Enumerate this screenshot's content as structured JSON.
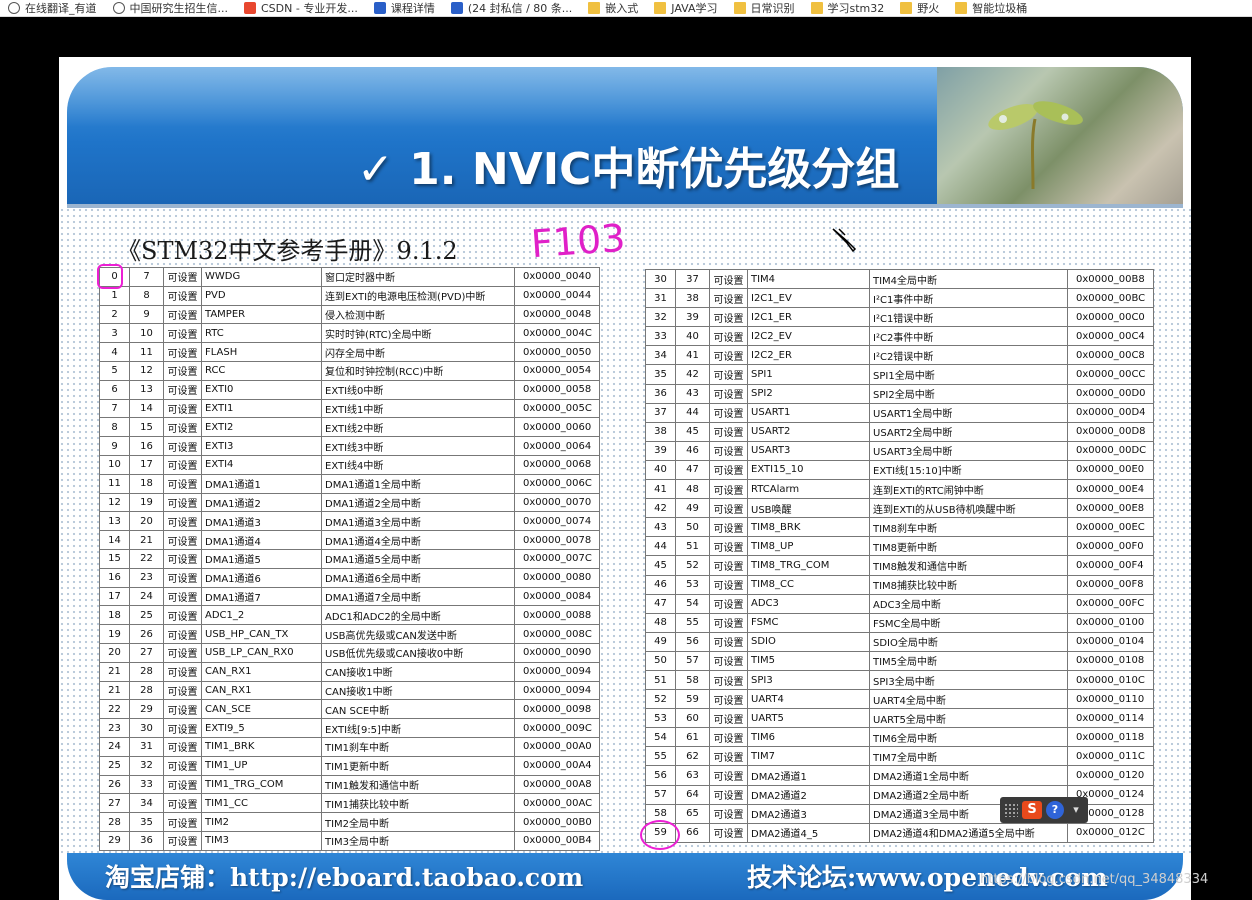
{
  "bookmarks": [
    {
      "icon": "globe-icon",
      "label": "在线翻译_有道"
    },
    {
      "icon": "globe-icon",
      "label": "中国研究生招生信..."
    },
    {
      "icon": "csdn-icon",
      "label": "CSDN - 专业开发..."
    },
    {
      "icon": "doc-icon",
      "label": "课程详情"
    },
    {
      "icon": "xu-icon",
      "label": "(24 封私信 / 80 条..."
    },
    {
      "icon": "folder-icon",
      "label": "嵌入式"
    },
    {
      "icon": "folder-icon",
      "label": "JAVA学习"
    },
    {
      "icon": "folder-icon",
      "label": "日常识别"
    },
    {
      "icon": "folder-icon",
      "label": "学习stm32"
    },
    {
      "icon": "folder-icon",
      "label": "野火"
    },
    {
      "icon": "folder-icon",
      "label": "智能垃圾桶"
    }
  ],
  "slide": {
    "title": "✓ 1. NVIC中断优先级分组",
    "subtitle": "《STM32中文参考手册》9.1.2",
    "annotation": "F103",
    "footer_shop": "淘宝店铺：http://eboard.taobao.com",
    "footer_forum": "技术论坛:www.openedv.com"
  },
  "table_left": [
    [
      "0",
      "7",
      "可设置",
      "WWDG",
      "窗口定时器中断",
      "0x0000_0040"
    ],
    [
      "1",
      "8",
      "可设置",
      "PVD",
      "连到EXTI的电源电压检测(PVD)中断",
      "0x0000_0044"
    ],
    [
      "2",
      "9",
      "可设置",
      "TAMPER",
      "侵入检测中断",
      "0x0000_0048"
    ],
    [
      "3",
      "10",
      "可设置",
      "RTC",
      "实时时钟(RTC)全局中断",
      "0x0000_004C"
    ],
    [
      "4",
      "11",
      "可设置",
      "FLASH",
      "闪存全局中断",
      "0x0000_0050"
    ],
    [
      "5",
      "12",
      "可设置",
      "RCC",
      "复位和时钟控制(RCC)中断",
      "0x0000_0054"
    ],
    [
      "6",
      "13",
      "可设置",
      "EXTI0",
      "EXTI线0中断",
      "0x0000_0058"
    ],
    [
      "7",
      "14",
      "可设置",
      "EXTI1",
      "EXTI线1中断",
      "0x0000_005C"
    ],
    [
      "8",
      "15",
      "可设置",
      "EXTI2",
      "EXTI线2中断",
      "0x0000_0060"
    ],
    [
      "9",
      "16",
      "可设置",
      "EXTI3",
      "EXTI线3中断",
      "0x0000_0064"
    ],
    [
      "10",
      "17",
      "可设置",
      "EXTI4",
      "EXTI线4中断",
      "0x0000_0068"
    ],
    [
      "11",
      "18",
      "可设置",
      "DMA1通道1",
      "DMA1通道1全局中断",
      "0x0000_006C"
    ],
    [
      "12",
      "19",
      "可设置",
      "DMA1通道2",
      "DMA1通道2全局中断",
      "0x0000_0070"
    ],
    [
      "13",
      "20",
      "可设置",
      "DMA1通道3",
      "DMA1通道3全局中断",
      "0x0000_0074"
    ],
    [
      "14",
      "21",
      "可设置",
      "DMA1通道4",
      "DMA1通道4全局中断",
      "0x0000_0078"
    ],
    [
      "15",
      "22",
      "可设置",
      "DMA1通道5",
      "DMA1通道5全局中断",
      "0x0000_007C"
    ],
    [
      "16",
      "23",
      "可设置",
      "DMA1通道6",
      "DMA1通道6全局中断",
      "0x0000_0080"
    ],
    [
      "17",
      "24",
      "可设置",
      "DMA1通道7",
      "DMA1通道7全局中断",
      "0x0000_0084"
    ],
    [
      "18",
      "25",
      "可设置",
      "ADC1_2",
      "ADC1和ADC2的全局中断",
      "0x0000_0088"
    ],
    [
      "19",
      "26",
      "可设置",
      "USB_HP_CAN_TX",
      "USB高优先级或CAN发送中断",
      "0x0000_008C"
    ],
    [
      "20",
      "27",
      "可设置",
      "USB_LP_CAN_RX0",
      "USB低优先级或CAN接收0中断",
      "0x0000_0090"
    ],
    [
      "21",
      "28",
      "可设置",
      "CAN_RX1",
      "CAN接收1中断",
      "0x0000_0094"
    ],
    [
      "21",
      "28",
      "可设置",
      "CAN_RX1",
      "CAN接收1中断",
      "0x0000_0094"
    ],
    [
      "22",
      "29",
      "可设置",
      "CAN_SCE",
      "CAN SCE中断",
      "0x0000_0098"
    ],
    [
      "23",
      "30",
      "可设置",
      "EXTI9_5",
      "EXTI线[9:5]中断",
      "0x0000_009C"
    ],
    [
      "24",
      "31",
      "可设置",
      "TIM1_BRK",
      "TIM1刹车中断",
      "0x0000_00A0"
    ],
    [
      "25",
      "32",
      "可设置",
      "TIM1_UP",
      "TIM1更新中断",
      "0x0000_00A4"
    ],
    [
      "26",
      "33",
      "可设置",
      "TIM1_TRG_COM",
      "TIM1触发和通信中断",
      "0x0000_00A8"
    ],
    [
      "27",
      "34",
      "可设置",
      "TIM1_CC",
      "TIM1捕获比较中断",
      "0x0000_00AC"
    ],
    [
      "28",
      "35",
      "可设置",
      "TIM2",
      "TIM2全局中断",
      "0x0000_00B0"
    ],
    [
      "29",
      "36",
      "可设置",
      "TIM3",
      "TIM3全局中断",
      "0x0000_00B4"
    ]
  ],
  "table_right": [
    [
      "30",
      "37",
      "可设置",
      "TIM4",
      "TIM4全局中断",
      "0x0000_00B8"
    ],
    [
      "31",
      "38",
      "可设置",
      "I2C1_EV",
      "I²C1事件中断",
      "0x0000_00BC"
    ],
    [
      "32",
      "39",
      "可设置",
      "I2C1_ER",
      "I²C1错误中断",
      "0x0000_00C0"
    ],
    [
      "33",
      "40",
      "可设置",
      "I2C2_EV",
      "I²C2事件中断",
      "0x0000_00C4"
    ],
    [
      "34",
      "41",
      "可设置",
      "I2C2_ER",
      "I²C2错误中断",
      "0x0000_00C8"
    ],
    [
      "35",
      "42",
      "可设置",
      "SPI1",
      "SPI1全局中断",
      "0x0000_00CC"
    ],
    [
      "36",
      "43",
      "可设置",
      "SPI2",
      "SPI2全局中断",
      "0x0000_00D0"
    ],
    [
      "37",
      "44",
      "可设置",
      "USART1",
      "USART1全局中断",
      "0x0000_00D4"
    ],
    [
      "38",
      "45",
      "可设置",
      "USART2",
      "USART2全局中断",
      "0x0000_00D8"
    ],
    [
      "39",
      "46",
      "可设置",
      "USART3",
      "USART3全局中断",
      "0x0000_00DC"
    ],
    [
      "40",
      "47",
      "可设置",
      "EXTI15_10",
      "EXTI线[15:10]中断",
      "0x0000_00E0"
    ],
    [
      "41",
      "48",
      "可设置",
      "RTCAlarm",
      "连到EXTI的RTC闹钟中断",
      "0x0000_00E4"
    ],
    [
      "42",
      "49",
      "可设置",
      "USB唤醒",
      "连到EXTI的从USB待机唤醒中断",
      "0x0000_00E8"
    ],
    [
      "43",
      "50",
      "可设置",
      "TIM8_BRK",
      "TIM8刹车中断",
      "0x0000_00EC"
    ],
    [
      "44",
      "51",
      "可设置",
      "TIM8_UP",
      "TIM8更新中断",
      "0x0000_00F0"
    ],
    [
      "45",
      "52",
      "可设置",
      "TIM8_TRG_COM",
      "TIM8触发和通信中断",
      "0x0000_00F4"
    ],
    [
      "46",
      "53",
      "可设置",
      "TIM8_CC",
      "TIM8捕获比较中断",
      "0x0000_00F8"
    ],
    [
      "47",
      "54",
      "可设置",
      "ADC3",
      "ADC3全局中断",
      "0x0000_00FC"
    ],
    [
      "48",
      "55",
      "可设置",
      "FSMC",
      "FSMC全局中断",
      "0x0000_0100"
    ],
    [
      "49",
      "56",
      "可设置",
      "SDIO",
      "SDIO全局中断",
      "0x0000_0104"
    ],
    [
      "50",
      "57",
      "可设置",
      "TIM5",
      "TIM5全局中断",
      "0x0000_0108"
    ],
    [
      "51",
      "58",
      "可设置",
      "SPI3",
      "SPI3全局中断",
      "0x0000_010C"
    ],
    [
      "52",
      "59",
      "可设置",
      "UART4",
      "UART4全局中断",
      "0x0000_0110"
    ],
    [
      "53",
      "60",
      "可设置",
      "UART5",
      "UART5全局中断",
      "0x0000_0114"
    ],
    [
      "54",
      "61",
      "可设置",
      "TIM6",
      "TIM6全局中断",
      "0x0000_0118"
    ],
    [
      "55",
      "62",
      "可设置",
      "TIM7",
      "TIM7全局中断",
      "0x0000_011C"
    ],
    [
      "56",
      "63",
      "可设置",
      "DMA2通道1",
      "DMA2通道1全局中断",
      "0x0000_0120"
    ],
    [
      "57",
      "64",
      "可设置",
      "DMA2通道2",
      "DMA2通道2全局中断",
      "0x0000_0124"
    ],
    [
      "58",
      "65",
      "可设置",
      "DMA2通道3",
      "DMA2通道3全局中断",
      "0x0000_0128"
    ],
    [
      "59",
      "66",
      "可设置",
      "DMA2通道4_5",
      "DMA2通道4和DMA2通道5全局中断",
      "0x0000_012C"
    ]
  ],
  "watermark": "https://blog.csdn.net/qq_34848334",
  "ime": {
    "logo": "S",
    "help": "?"
  },
  "colors": {
    "banner": "#1f74c9",
    "annotation": "#e020c8",
    "footer": "#1b69bd"
  }
}
